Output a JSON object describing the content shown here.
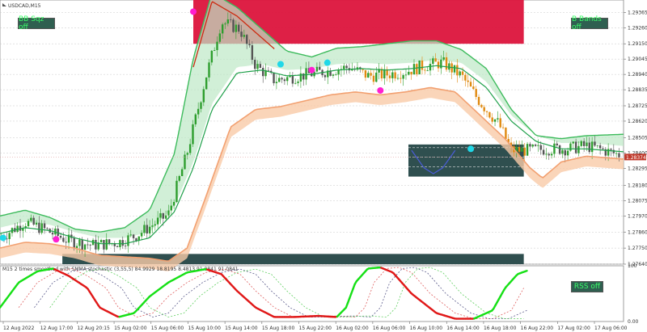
{
  "symbol_label": "USDCAD,M15",
  "osc_label": "M15 2 times smoothed with SMMA stochastic (3,55,5) 84.9929 18.8195 8.4813 91.0841 91.0841",
  "buttons": {
    "bb_sqz": "BB Sqz off",
    "b_bands": "B Bands off",
    "rss": "RSS off"
  },
  "colors": {
    "up": "#2e9e2e",
    "down": "#e08a10",
    "gray": "#555555",
    "band_outer": "#3dbb5c",
    "band_lower": "#f2a070",
    "red_zone": "#dc143c",
    "dark_zone": "#2f4f4f",
    "cyan_dot": "#20d8e8",
    "magenta_dot": "#ff1fd0",
    "osc_up": "#16e016",
    "osc_down": "#e01818",
    "price_tag": "#c0392b"
  },
  "chart_data": [
    {
      "type": "candlestick",
      "title": "USDCAD,M15",
      "ylim": [
        1.2764,
        1.2945
      ],
      "y_ticks": [
        1.29365,
        1.2926,
        1.2915,
        1.29045,
        1.2894,
        1.28835,
        1.28725,
        1.2862,
        1.28505,
        1.284,
        1.28295,
        1.2818,
        1.28075,
        1.2797,
        1.2786,
        1.2775,
        1.2764
      ],
      "y_tick_labels": [
        "1.29365",
        "1.29260",
        "1.29150",
        "1.29045",
        "1.28940",
        "1.28835",
        "1.28725",
        "1.28620",
        "1.28505",
        "1.28400",
        "1.28295",
        "1.28180",
        "1.28075",
        "1.27970",
        "1.27860",
        "1.27750",
        "1.27640"
      ],
      "current_price": "1.28374",
      "current_price_value": 1.28374,
      "close_path": [
        [
          0,
          1.2782
        ],
        [
          0.04,
          1.2793
        ],
        [
          0.07,
          1.2788
        ],
        [
          0.11,
          1.278
        ],
        [
          0.15,
          1.2777
        ],
        [
          0.19,
          1.2779
        ],
        [
          0.22,
          1.2784
        ],
        [
          0.27,
          1.2798
        ],
        [
          0.3,
          1.284
        ],
        [
          0.33,
          1.2892
        ],
        [
          0.355,
          1.293
        ],
        [
          0.385,
          1.2925
        ],
        [
          0.41,
          1.29
        ],
        [
          0.44,
          1.289
        ],
        [
          0.48,
          1.2893
        ],
        [
          0.52,
          1.2896
        ],
        [
          0.56,
          1.2899
        ],
        [
          0.59,
          1.2893
        ],
        [
          0.62,
          1.2894
        ],
        [
          0.65,
          1.2896
        ],
        [
          0.68,
          1.29
        ],
        [
          0.71,
          1.2902
        ],
        [
          0.74,
          1.2893
        ],
        [
          0.77,
          1.2875
        ],
        [
          0.8,
          1.286
        ],
        [
          0.82,
          1.2842
        ],
        [
          0.85,
          1.2842
        ],
        [
          0.88,
          1.2843
        ],
        [
          0.91,
          1.2843
        ],
        [
          0.94,
          1.2845
        ],
        [
          0.96,
          1.2843
        ],
        [
          1.0,
          1.2838
        ]
      ],
      "upper_band_path": [
        [
          0,
          1.2797
        ],
        [
          0.04,
          1.2801
        ],
        [
          0.08,
          1.2796
        ],
        [
          0.12,
          1.2788
        ],
        [
          0.16,
          1.2786
        ],
        [
          0.2,
          1.2789
        ],
        [
          0.24,
          1.2801
        ],
        [
          0.28,
          1.284
        ],
        [
          0.31,
          1.2905
        ],
        [
          0.34,
          1.295
        ],
        [
          0.38,
          1.294
        ],
        [
          0.42,
          1.2925
        ],
        [
          0.46,
          1.291
        ],
        [
          0.5,
          1.2906
        ],
        [
          0.54,
          1.2912
        ],
        [
          0.58,
          1.2913
        ],
        [
          0.62,
          1.2915
        ],
        [
          0.66,
          1.2917
        ],
        [
          0.7,
          1.2917
        ],
        [
          0.74,
          1.2911
        ],
        [
          0.78,
          1.2898
        ],
        [
          0.82,
          1.287
        ],
        [
          0.86,
          1.2852
        ],
        [
          0.9,
          1.285
        ],
        [
          0.94,
          1.2852
        ],
        [
          1.0,
          1.2853
        ]
      ],
      "middle_band_path": [
        [
          0,
          1.2785
        ],
        [
          0.04,
          1.2789
        ],
        [
          0.08,
          1.2787
        ],
        [
          0.12,
          1.2782
        ],
        [
          0.16,
          1.2778
        ],
        [
          0.2,
          1.2778
        ],
        [
          0.24,
          1.2782
        ],
        [
          0.28,
          1.28
        ],
        [
          0.31,
          1.283
        ],
        [
          0.34,
          1.287
        ],
        [
          0.38,
          1.2895
        ],
        [
          0.42,
          1.2897
        ],
        [
          0.46,
          1.2893
        ],
        [
          0.5,
          1.2894
        ],
        [
          0.54,
          1.2897
        ],
        [
          0.58,
          1.2898
        ],
        [
          0.62,
          1.2897
        ],
        [
          0.66,
          1.2898
        ],
        [
          0.7,
          1.29
        ],
        [
          0.74,
          1.2898
        ],
        [
          0.78,
          1.2885
        ],
        [
          0.82,
          1.2862
        ],
        [
          0.86,
          1.2848
        ],
        [
          0.9,
          1.2843
        ],
        [
          0.94,
          1.2843
        ],
        [
          1.0,
          1.2841
        ]
      ],
      "lower_band_path": [
        [
          0,
          1.2775
        ],
        [
          0.04,
          1.2779
        ],
        [
          0.08,
          1.2778
        ],
        [
          0.12,
          1.2775
        ],
        [
          0.16,
          1.277
        ],
        [
          0.2,
          1.2769
        ],
        [
          0.24,
          1.2768
        ],
        [
          0.27,
          1.2766
        ],
        [
          0.3,
          1.2775
        ],
        [
          0.33,
          1.281
        ],
        [
          0.37,
          1.2858
        ],
        [
          0.41,
          1.287
        ],
        [
          0.45,
          1.2872
        ],
        [
          0.49,
          1.2876
        ],
        [
          0.53,
          1.288
        ],
        [
          0.57,
          1.2882
        ],
        [
          0.61,
          1.288
        ],
        [
          0.65,
          1.2882
        ],
        [
          0.69,
          1.2885
        ],
        [
          0.73,
          1.2882
        ],
        [
          0.77,
          1.2866
        ],
        [
          0.81,
          1.285
        ],
        [
          0.85,
          1.283
        ],
        [
          0.87,
          1.2823
        ],
        [
          0.9,
          1.2834
        ],
        [
          0.94,
          1.2838
        ],
        [
          1.0,
          1.2836
        ]
      ],
      "zones": [
        {
          "x0": 0.31,
          "x1": 0.84,
          "y0": 1.2915,
          "y1": 1.2945,
          "kind": "red"
        },
        {
          "x0": 0.655,
          "x1": 0.84,
          "y0": 1.2824,
          "y1": 1.2846,
          "kind": "dark"
        },
        {
          "x0": 0.1,
          "x1": 0.84,
          "y0": 1.2764,
          "y1": 1.2771,
          "kind": "dark"
        }
      ],
      "dots": [
        {
          "x": 0.005,
          "y": 1.2782,
          "kind": "cyan"
        },
        {
          "x": 0.09,
          "y": 1.2781,
          "kind": "magenta"
        },
        {
          "x": 0.31,
          "y": 1.2937,
          "kind": "magenta"
        },
        {
          "x": 0.45,
          "y": 1.2901,
          "kind": "cyan"
        },
        {
          "x": 0.5,
          "y": 1.2897,
          "kind": "magenta"
        },
        {
          "x": 0.525,
          "y": 1.2902,
          "kind": "cyan"
        },
        {
          "x": 0.61,
          "y": 1.2883,
          "kind": "magenta"
        },
        {
          "x": 0.755,
          "y": 1.2843,
          "kind": "cyan"
        }
      ]
    },
    {
      "type": "line",
      "title": "M15 2 times smoothed with SMMA stochastic (3,55,5) 84.9929 18.8195 8.4813 91.0841 91.0841",
      "ylim": [
        0,
        100
      ],
      "y_tick_labels": [
        "100",
        "0.00"
      ],
      "main_path": [
        [
          0,
          25
        ],
        [
          0.03,
          70
        ],
        [
          0.06,
          90
        ],
        [
          0.085,
          95
        ],
        [
          0.11,
          82
        ],
        [
          0.14,
          60
        ],
        [
          0.16,
          25
        ],
        [
          0.19,
          8
        ],
        [
          0.215,
          15
        ],
        [
          0.24,
          45
        ],
        [
          0.27,
          70
        ],
        [
          0.3,
          88
        ],
        [
          0.33,
          94
        ],
        [
          0.355,
          85
        ],
        [
          0.38,
          55
        ],
        [
          0.41,
          25
        ],
        [
          0.44,
          8
        ],
        [
          0.47,
          8
        ],
        [
          0.51,
          10
        ],
        [
          0.54,
          8
        ],
        [
          0.555,
          25
        ],
        [
          0.57,
          70
        ],
        [
          0.59,
          95
        ],
        [
          0.61,
          97
        ],
        [
          0.63,
          88
        ],
        [
          0.66,
          50
        ],
        [
          0.7,
          15
        ],
        [
          0.73,
          5
        ],
        [
          0.76,
          5
        ],
        [
          0.79,
          20
        ],
        [
          0.81,
          60
        ],
        [
          0.83,
          85
        ],
        [
          0.845,
          91
        ]
      ],
      "main_up_segments": [
        [
          0.0,
          0.085
        ],
        [
          0.19,
          0.33
        ],
        [
          0.54,
          0.61
        ],
        [
          0.76,
          0.845
        ]
      ],
      "x_tick_labels": [
        "12 Aug 2022",
        "12 Aug 17:00",
        "12 Aug 20:15",
        "15 Aug 02:00",
        "15 Aug 06:00",
        "15 Aug 10:00",
        "15 Aug 14:00",
        "15 Aug 18:00",
        "15 Aug 22:00",
        "16 Aug 02:00",
        "16 Aug 06:00",
        "16 Aug 10:00",
        "16 Aug 14:00",
        "16 Aug 18:00",
        "16 Aug 22:00",
        "17 Aug 02:00",
        "17 Aug 06:00"
      ],
      "xlabel": "",
      "ylabel": ""
    }
  ]
}
